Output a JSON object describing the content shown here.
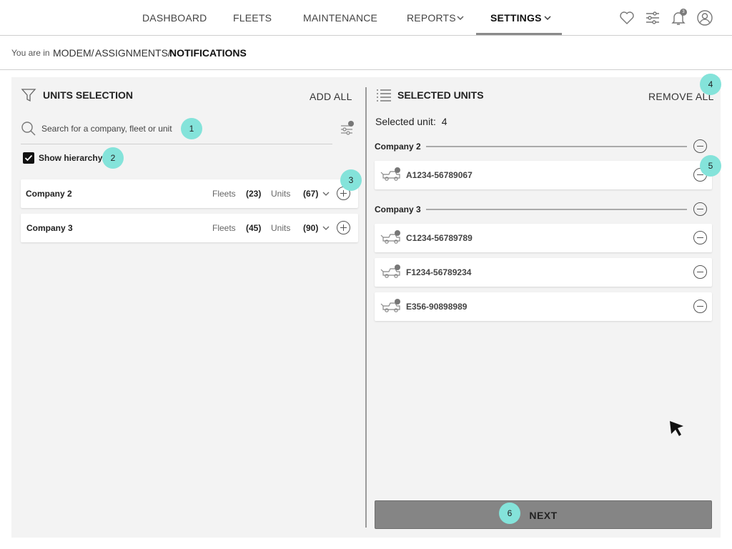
{
  "nav": {
    "items": [
      {
        "label": "DASHBOARD"
      },
      {
        "label": "FLEETS"
      },
      {
        "label": "MAINTENANCE"
      },
      {
        "label": "REPORTS"
      },
      {
        "label": "SETTINGS"
      }
    ],
    "active": "SETTINGS",
    "notification_count": "3",
    "icons": [
      "heart-icon",
      "sliders-icon",
      "bell-icon",
      "user-icon"
    ]
  },
  "breadcrumb": {
    "prefix": "You are in",
    "items": [
      "MODEM/",
      "ASSIGNMENTS/"
    ],
    "current": "NOTIFICATIONS"
  },
  "units_selection": {
    "title": "UNITS SELECTION",
    "add_all": "ADD ALL",
    "search_placeholder": "Search for a company, fleet or unit",
    "show_hierarchy": "Show hierarchy",
    "show_hierarchy_checked": true,
    "companies": [
      {
        "name": "Company 2",
        "fleets_label": "Fleets",
        "fleets": "(23)",
        "units_label": "Units",
        "units": "(67)"
      },
      {
        "name": "Company 3",
        "fleets_label": "Fleets",
        "fleets": "(45)",
        "units_label": "Units",
        "units": "(90)"
      }
    ]
  },
  "selected_units": {
    "title": "SELECTED UNITS",
    "remove_all": "REMOVE ALL",
    "count_label": "Selected unit:",
    "count": "4",
    "groups": [
      {
        "name": "Company 2",
        "units": [
          "A1234-56789067"
        ]
      },
      {
        "name": "Company 3",
        "units": [
          "C1234-56789789",
          "F1234-56789234",
          "E356-90898989"
        ]
      }
    ]
  },
  "next_label": "NEXT",
  "markers": [
    "1",
    "2",
    "3",
    "4",
    "5",
    "6"
  ],
  "colors": {
    "marker": "#84e3da",
    "panel": "#f3f3f3",
    "next_button": "#858585"
  }
}
